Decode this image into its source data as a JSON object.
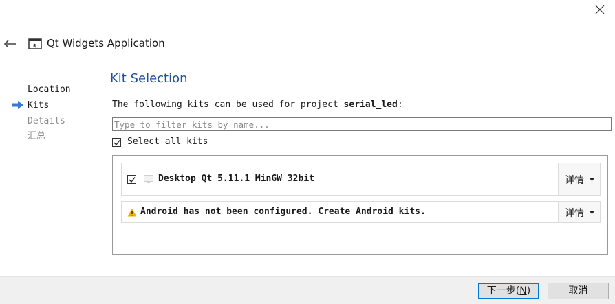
{
  "window": {
    "title": "Qt Widgets Application"
  },
  "steps": [
    {
      "label": "Location",
      "state": "done"
    },
    {
      "label": "Kits",
      "state": "current"
    },
    {
      "label": "Details",
      "state": "pending"
    },
    {
      "label": "汇总",
      "state": "pending"
    }
  ],
  "page": {
    "title": "Kit Selection",
    "description_prefix": "The following kits can be used for project ",
    "project_name": "serial_led",
    "description_suffix": ":",
    "filter_placeholder": "Type to filter kits by name...",
    "select_all_label": "Select all kits",
    "select_all_checked": true
  },
  "kits": [
    {
      "name": "Desktop Qt 5.11.1 MinGW 32bit",
      "checked": true,
      "details_label": "详情"
    }
  ],
  "warning": {
    "text": "Android has not been configured. Create Android kits.",
    "details_label": "详情"
  },
  "footer": {
    "next_label": "下一步(",
    "next_mnemonic": "N",
    "next_suffix": ")",
    "cancel_label": "取消"
  },
  "colors": {
    "accent": "#0078d7",
    "title_blue": "#1f4e9c",
    "warning": "#f0b400",
    "step_arrow": "#3a78d4"
  },
  "icons": {
    "close": "close-icon",
    "back": "back-arrow-icon",
    "app": "window-icon",
    "step": "arrow-right-icon",
    "monitor": "monitor-icon",
    "warning": "warning-icon",
    "dropdown": "chevron-down-icon"
  }
}
